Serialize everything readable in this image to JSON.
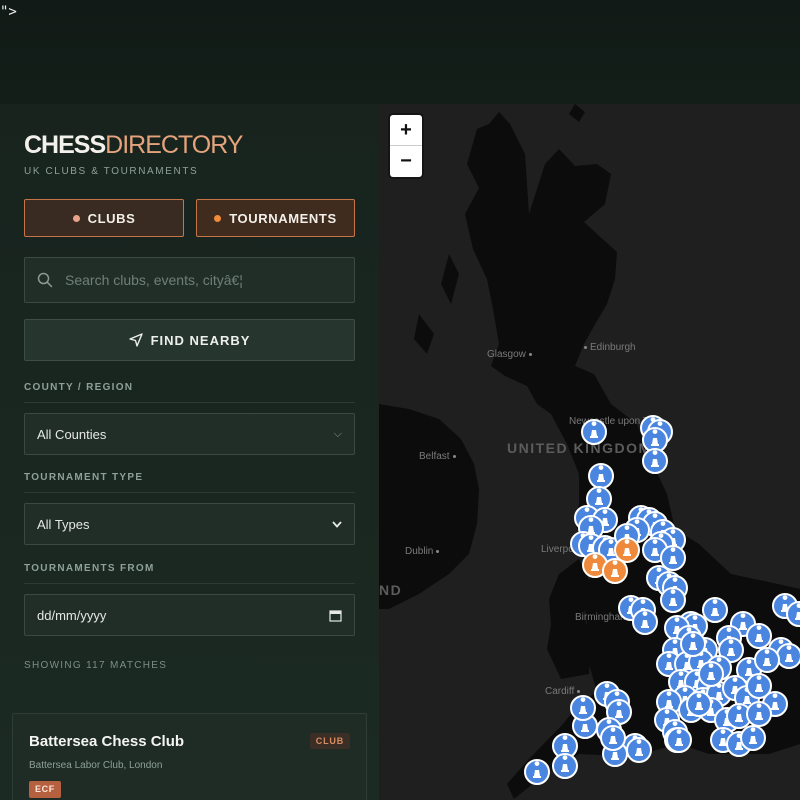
{
  "stray_text": "\">",
  "brand": {
    "part1": "CHESS",
    "part2": "DIRECTORY",
    "tagline": "UK CLUBS & TOURNAMENTS"
  },
  "toggles": {
    "clubs": "CLUBS",
    "tournaments": "TOURNAMENTS"
  },
  "search": {
    "placeholder": "Search clubs, events, cityâ€¦"
  },
  "find_nearby": "FIND NEARBY",
  "filters": {
    "county_label": "COUNTY / REGION",
    "county_value": "All Counties",
    "type_label": "TOURNAMENT TYPE",
    "type_value": "All Types",
    "from_label": "TOURNAMENTS FROM",
    "from_value": "dd/mm/yyyy"
  },
  "count_text": "SHOWING 117 MATCHES",
  "card": {
    "name": "Battersea Chess Club",
    "kind": "CLUB",
    "address": "Battersea Labor Club, London",
    "badge": "ECF"
  },
  "map": {
    "zoom_in": "+",
    "zoom_out": "−",
    "labels": {
      "edinburgh": "Edinburgh",
      "glasgow": "Glasgow",
      "newcastle": "Newcastle upon Tyne",
      "belfast": "Belfast",
      "country": "UNITED KINGDOM",
      "dublin": "Dublin",
      "liverpool": "Liverpool",
      "birmingham": "Birmingham",
      "cardiff": "Cardiff",
      "ireland_fragment": "ND"
    },
    "marker_colors": {
      "club": "#4a86e0",
      "tournament": "#ef8a3c"
    },
    "club_marker_icon": "chess-pawn-icon",
    "tournament_marker_icon": "chess-pawn-icon"
  }
}
